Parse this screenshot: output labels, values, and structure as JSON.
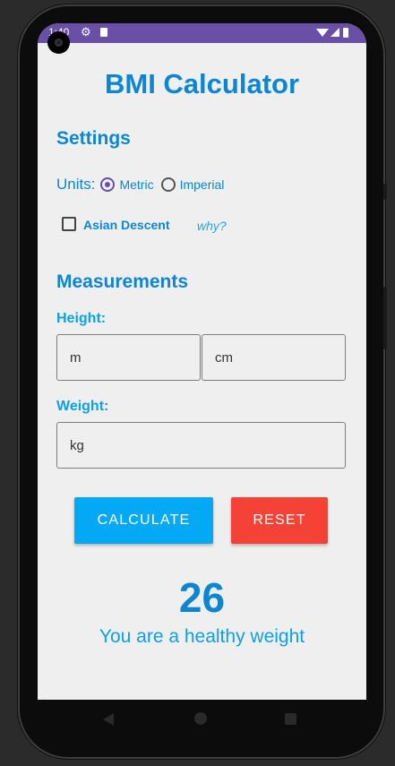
{
  "status_bar": {
    "time": "1:40"
  },
  "app": {
    "title": "BMI Calculator"
  },
  "settings": {
    "heading": "Settings",
    "units_label": "Units:",
    "unit_options": [
      "Metric",
      "Imperial"
    ],
    "selected_unit": "Metric",
    "asian_descent_label": "Asian Descent",
    "asian_descent_checked": false,
    "why_link": "why?"
  },
  "measurements": {
    "heading": "Measurements",
    "height_label": "Height:",
    "height_m_placeholder": "m",
    "height_cm_placeholder": "cm",
    "weight_label": "Weight:",
    "weight_placeholder": "kg"
  },
  "actions": {
    "calculate": "CALCULATE",
    "reset": "RESET"
  },
  "result": {
    "bmi": "26",
    "message": "You are a healthy weight"
  },
  "colors": {
    "primary": "#0c86d0",
    "accent": "#0ca0e6",
    "calculate_button": "#03a9f4",
    "reset_button": "#f44336",
    "status_bar": "#6a4fa7"
  }
}
